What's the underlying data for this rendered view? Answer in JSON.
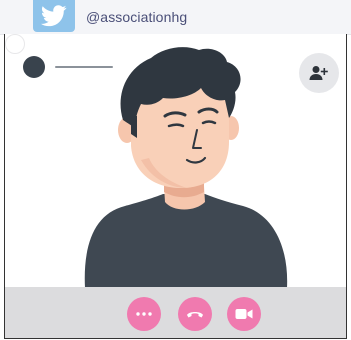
{
  "header": {
    "platform_icon": "twitter-bird-icon",
    "handle": "@associationhg"
  },
  "call": {
    "caller_avatar": "avatar",
    "add_participant_icon": "add-user-icon"
  },
  "controls": [
    {
      "name": "more-options",
      "icon": "ellipsis-icon"
    },
    {
      "name": "end-call",
      "icon": "phone-hangup-icon"
    },
    {
      "name": "toggle-video",
      "icon": "video-camera-icon"
    }
  ],
  "colors": {
    "twitter_blue": "#8ec3ea",
    "handle_text": "#4a4f78",
    "control_pink": "#f07aaf",
    "control_bar": "#dcdcde",
    "shirt": "#3f4852",
    "skin": "#f6c6ad",
    "hair": "#2f3740"
  }
}
